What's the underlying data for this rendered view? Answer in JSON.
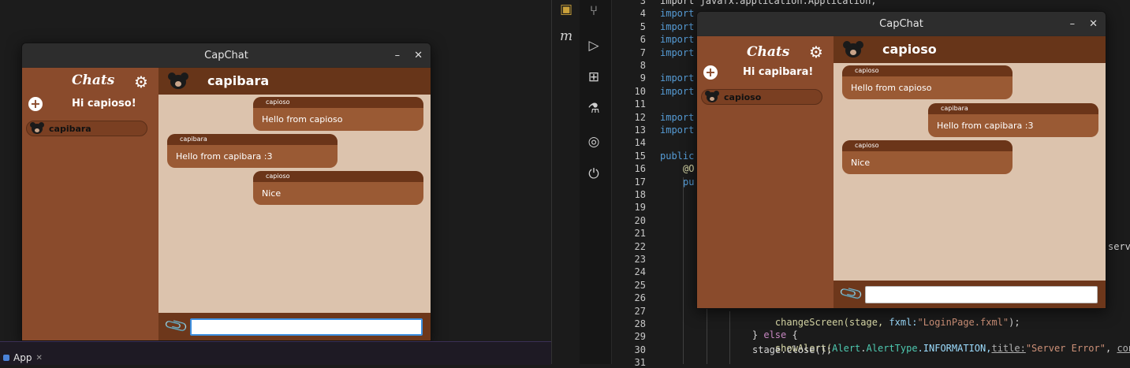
{
  "app": {
    "window_title": "CapChat",
    "minimize": "–",
    "close": "✕"
  },
  "taskbar": {
    "label": "App",
    "close": "✕"
  },
  "left_window": {
    "sidebar_title": "Chats",
    "greeting": "Hi capioso!",
    "contacts": [
      {
        "name": "capibara"
      }
    ],
    "chat_partner": "capibara",
    "messages": [
      {
        "sender": "capioso",
        "text": "Hello from capioso",
        "side": "right"
      },
      {
        "sender": "capibara",
        "text": "Hello from capibara :3",
        "side": "left"
      },
      {
        "sender": "capioso",
        "text": "Nice",
        "side": "right"
      }
    ],
    "input_value": ""
  },
  "right_window": {
    "sidebar_title": "Chats",
    "greeting": "Hi capibara!",
    "contacts": [
      {
        "name": "capioso"
      }
    ],
    "chat_partner": "capioso",
    "messages": [
      {
        "sender": "capioso",
        "text": "Hello from capioso",
        "side": "left"
      },
      {
        "sender": "capibara",
        "text": "Hello from capibara :3",
        "side": "right"
      },
      {
        "sender": "capioso",
        "text": "Nice",
        "side": "left"
      }
    ],
    "input_value": ""
  },
  "ide": {
    "line_numbers": [
      "3",
      "4",
      "5",
      "6",
      "7",
      "8",
      "9",
      "10",
      "11",
      "12",
      "13",
      "14",
      "15",
      "16",
      "17",
      "18",
      "19",
      "20",
      "21",
      "22",
      "23",
      "24",
      "25",
      "26",
      "27",
      "28",
      "29",
      "30",
      "31"
    ],
    "code": {
      "l3": "import javafx.application.Application;",
      "l4": "import",
      "l5": "import",
      "l6": "import",
      "l7": "import",
      "l9": "import",
      "l10": "import",
      "l12": "import",
      "l13": "import",
      "l15": "public",
      "l16": "@O",
      "l17": "pu",
      "l22_tail": "serv",
      "l27a": "changeScreen(stage, ",
      "l27b": "fxml:",
      "l27c": "\"LoginPage.fxml\"",
      "l27d": ");",
      "l28a": "} ",
      "l28b": "else",
      "l28c": " {",
      "l29a": "showAlert(",
      "l29b": "Alert",
      "l29c": ".",
      "l29d": "AlertType",
      "l29e": ".INFORMATION,",
      "l29f": "title:",
      "l29g": "\"Server Error\"",
      "l29h": ", ",
      "l29i": "conten",
      "l30": "stage.close();"
    }
  }
}
